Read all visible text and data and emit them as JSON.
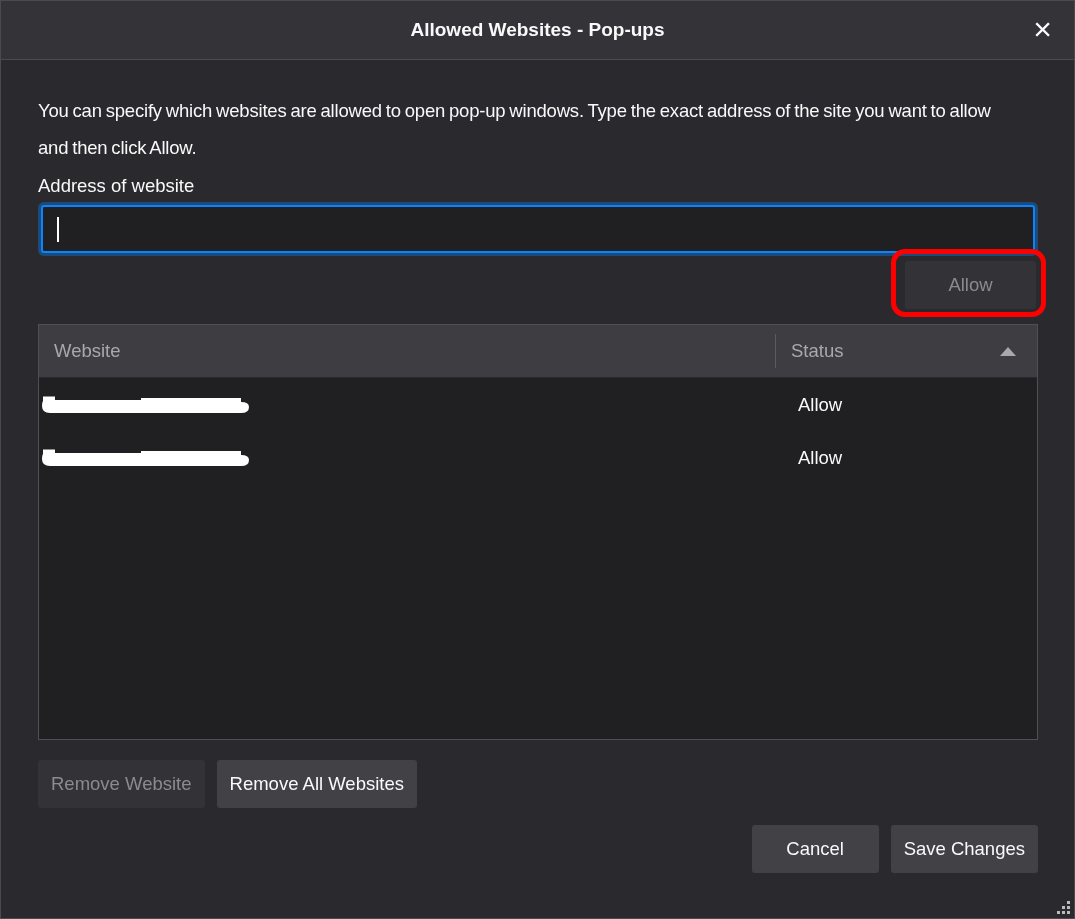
{
  "window": {
    "title": "Allowed Websites - Pop-ups",
    "close": "×"
  },
  "description": "You can specify which websites are allowed to open pop-up windows. Type the exact address of the site you want to allow and then click Allow.",
  "address_field": {
    "label": "Address of website",
    "focused": true
  },
  "allow_button": {
    "label": "Allow",
    "disabled": true,
    "highlighted": true
  },
  "table": {
    "columns": [
      {
        "label": "Website",
        "sorted": false
      },
      {
        "label": "Status",
        "sorted": true
      }
    ],
    "rows": [
      {
        "status": "Allow"
      },
      {
        "status": "Allow"
      }
    ]
  },
  "list_buttons": [
    {
      "label": "Remove Website",
      "disabled": true
    },
    {
      "label": "Remove All Websites",
      "disabled": false
    }
  ],
  "dialog_buttons": [
    {
      "label": "Cancel",
      "disabled": false
    },
    {
      "label": "Save Changes",
      "disabled": false
    }
  ]
}
